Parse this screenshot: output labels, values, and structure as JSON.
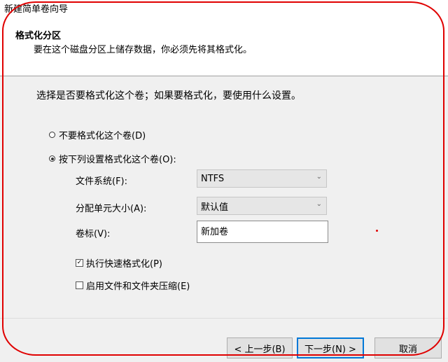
{
  "window": {
    "title": "新建简单卷向导"
  },
  "header": {
    "title": "格式化分区",
    "subtitle": "要在这个磁盘分区上储存数据，你必须先将其格式化。"
  },
  "main": {
    "instruction": "选择是否要格式化这个卷；如果要格式化，要使用什么设置。",
    "radio_no_format": {
      "label": "不要格式化这个卷(D)",
      "checked": false
    },
    "radio_format": {
      "label": "按下列设置格式化这个卷(O):",
      "checked": true
    },
    "file_system": {
      "label": "文件系统(F):",
      "value": "NTFS"
    },
    "allocation_unit": {
      "label": "分配单元大小(A):",
      "value": "默认值"
    },
    "volume_label": {
      "label": "卷标(V):",
      "value": "新加卷"
    },
    "quick_format": {
      "label": "执行快速格式化(P)",
      "checked": true
    },
    "compression": {
      "label": "启用文件和文件夹压缩(E)",
      "checked": false
    }
  },
  "footer": {
    "back_label": "< 上一步(B)",
    "next_label": "下一步(N) >",
    "cancel_label": "取消"
  },
  "colors": {
    "annotation_red": "#e00000",
    "focus_blue": "#0078d7"
  }
}
